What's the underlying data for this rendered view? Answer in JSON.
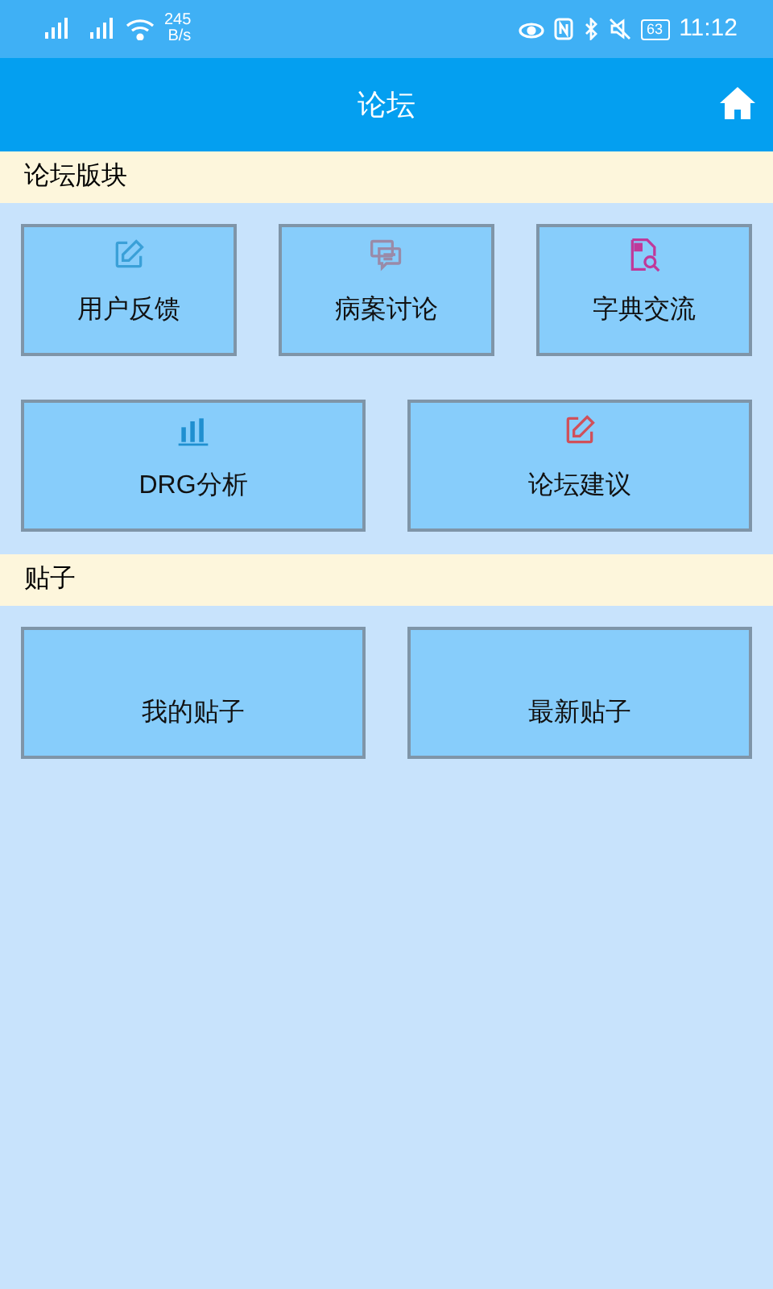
{
  "status_bar": {
    "speed_value": "245",
    "speed_unit": "B/s",
    "battery": "63",
    "time": "11:12"
  },
  "app_bar": {
    "title": "论坛"
  },
  "sections": [
    {
      "title": "论坛版块",
      "rows": [
        [
          {
            "label": "用户反馈",
            "kind": "edit",
            "color": "#3aa0d8"
          },
          {
            "label": "病案讨论",
            "kind": "chat",
            "color": "#9a8aa8"
          },
          {
            "label": "字典交流",
            "kind": "doc-search",
            "color": "#c0399a"
          }
        ],
        [
          {
            "label": "DRG分析",
            "kind": "bars",
            "color": "#1f8fd0"
          },
          {
            "label": "论坛建议",
            "kind": "edit",
            "color": "#d0505a"
          }
        ]
      ]
    },
    {
      "title": "贴子",
      "rows": [
        [
          {
            "label": "我的贴子",
            "kind": "none"
          },
          {
            "label": "最新贴子",
            "kind": "none"
          }
        ]
      ]
    }
  ]
}
